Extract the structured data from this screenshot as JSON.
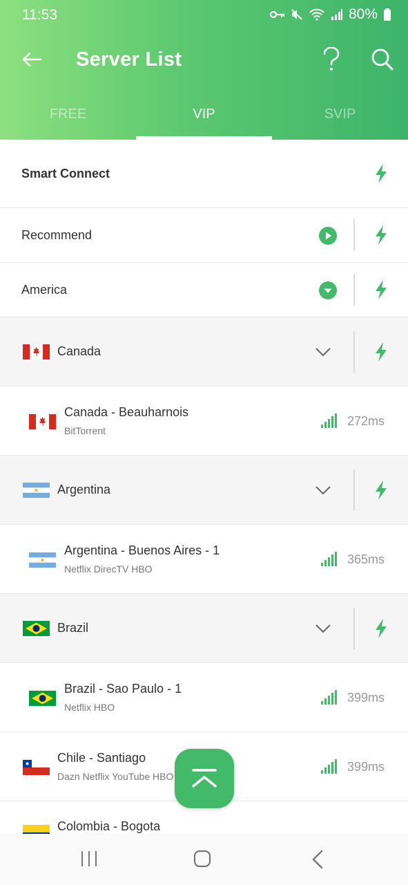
{
  "status_bar": {
    "time": "11:53",
    "battery": "80%"
  },
  "toolbar": {
    "title": "Server List"
  },
  "tabs": [
    {
      "label": "FREE",
      "active": false
    },
    {
      "label": "VIP",
      "active": true
    },
    {
      "label": "SVIP",
      "active": false
    }
  ],
  "list": {
    "smart_connect": "Smart Connect",
    "recommend": "Recommend",
    "america": "America",
    "canada": {
      "country": "Canada",
      "server_name": "Canada - Beauharnois",
      "server_tags": "BitTorrent",
      "latency": "272ms"
    },
    "argentina": {
      "country": "Argentina",
      "server_name": "Argentina - Buenos Aires - 1",
      "server_tags": "Netflix DirecTV HBO",
      "latency": "365ms"
    },
    "brazil": {
      "country": "Brazil",
      "server_name": "Brazil - Sao Paulo - 1",
      "server_tags": "Netflix HBO",
      "latency": "399ms"
    },
    "chile": {
      "server_name": "Chile - Santiago",
      "server_tags": "Dazn Netflix YouTube HBO",
      "latency": "399ms"
    },
    "colombia": {
      "server_name": "Colombia - Bogota"
    }
  },
  "colors": {
    "brand_green": "#43b96a",
    "header_start": "#8de07f",
    "header_end": "#3db46a"
  },
  "icons": {
    "back": "arrow-left-icon",
    "help": "question-mark-icon",
    "search": "search-icon",
    "bolt": "lightning-bolt-icon",
    "play": "play-circle-icon",
    "dropdown": "caret-down-circle-icon",
    "chevron": "chevron-down-icon",
    "signal": "signal-bars-icon",
    "fab": "scroll-to-top-icon"
  }
}
